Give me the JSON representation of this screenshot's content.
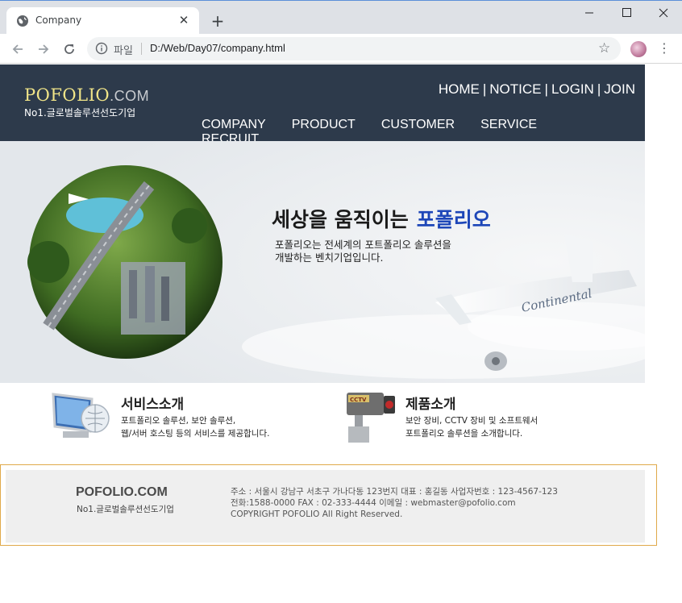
{
  "browser": {
    "tab_title": "Company",
    "tab_close": "✕",
    "new_tab": "+",
    "scheme_label": "파일",
    "url": "D:/Web/Day07/company.html"
  },
  "header": {
    "logo_main": "POFOLIO",
    "logo_dotcom": ".COM",
    "logo_sub": "No1.글로벌솔루션선도기업",
    "util_nav": [
      "HOME",
      "NOTICE",
      "LOGIN",
      "JOIN"
    ],
    "util_sep": "|",
    "main_nav": [
      "COMPANY",
      "PRODUCT",
      "CUSTOMER",
      "SERVICE",
      "RECRUIT"
    ]
  },
  "hero": {
    "title": "세상을 움직이는",
    "brand": "포폴리오",
    "desc_line1": "포폴리오는 전세계의 포트폴리오 솔루션을",
    "desc_line2": "개발하는 벤치기업입니다.",
    "plane_text": "Continental"
  },
  "services": [
    {
      "title": "서비스소개",
      "line1": "포트폴리오 솔루션, 보안 솔루션,",
      "line2": "웹/서버 호스팅 등의 서비스를 제공합니다."
    },
    {
      "title": "제품소개",
      "line1": "보안 장비, CCTV 장비 및 소프트웨서",
      "line2": "포트폴리오 솔루션을 소개합니다.",
      "camera_label": "CCTV"
    }
  ],
  "footer": {
    "logo": "POFOLIO.COM",
    "sub": "No1.글로벌솔루션선도기업",
    "line1": "주소 : 서울시 강남구 서초구 가나다동 123번지      대표 : 홍길동   사업자번호 : 123-4567-123",
    "line2": "전화:1588-0000      FAX : 02-333-4444    이메일 : webmaster@pofolio.com",
    "line3": "COPYRIGHT POFOLIO All Right Reserved."
  },
  "colors": {
    "header_bg": "#2d3a4b",
    "logo_yellow": "#f0e488",
    "brand_blue": "#1d46b8",
    "footer_border": "#e0a94a"
  }
}
